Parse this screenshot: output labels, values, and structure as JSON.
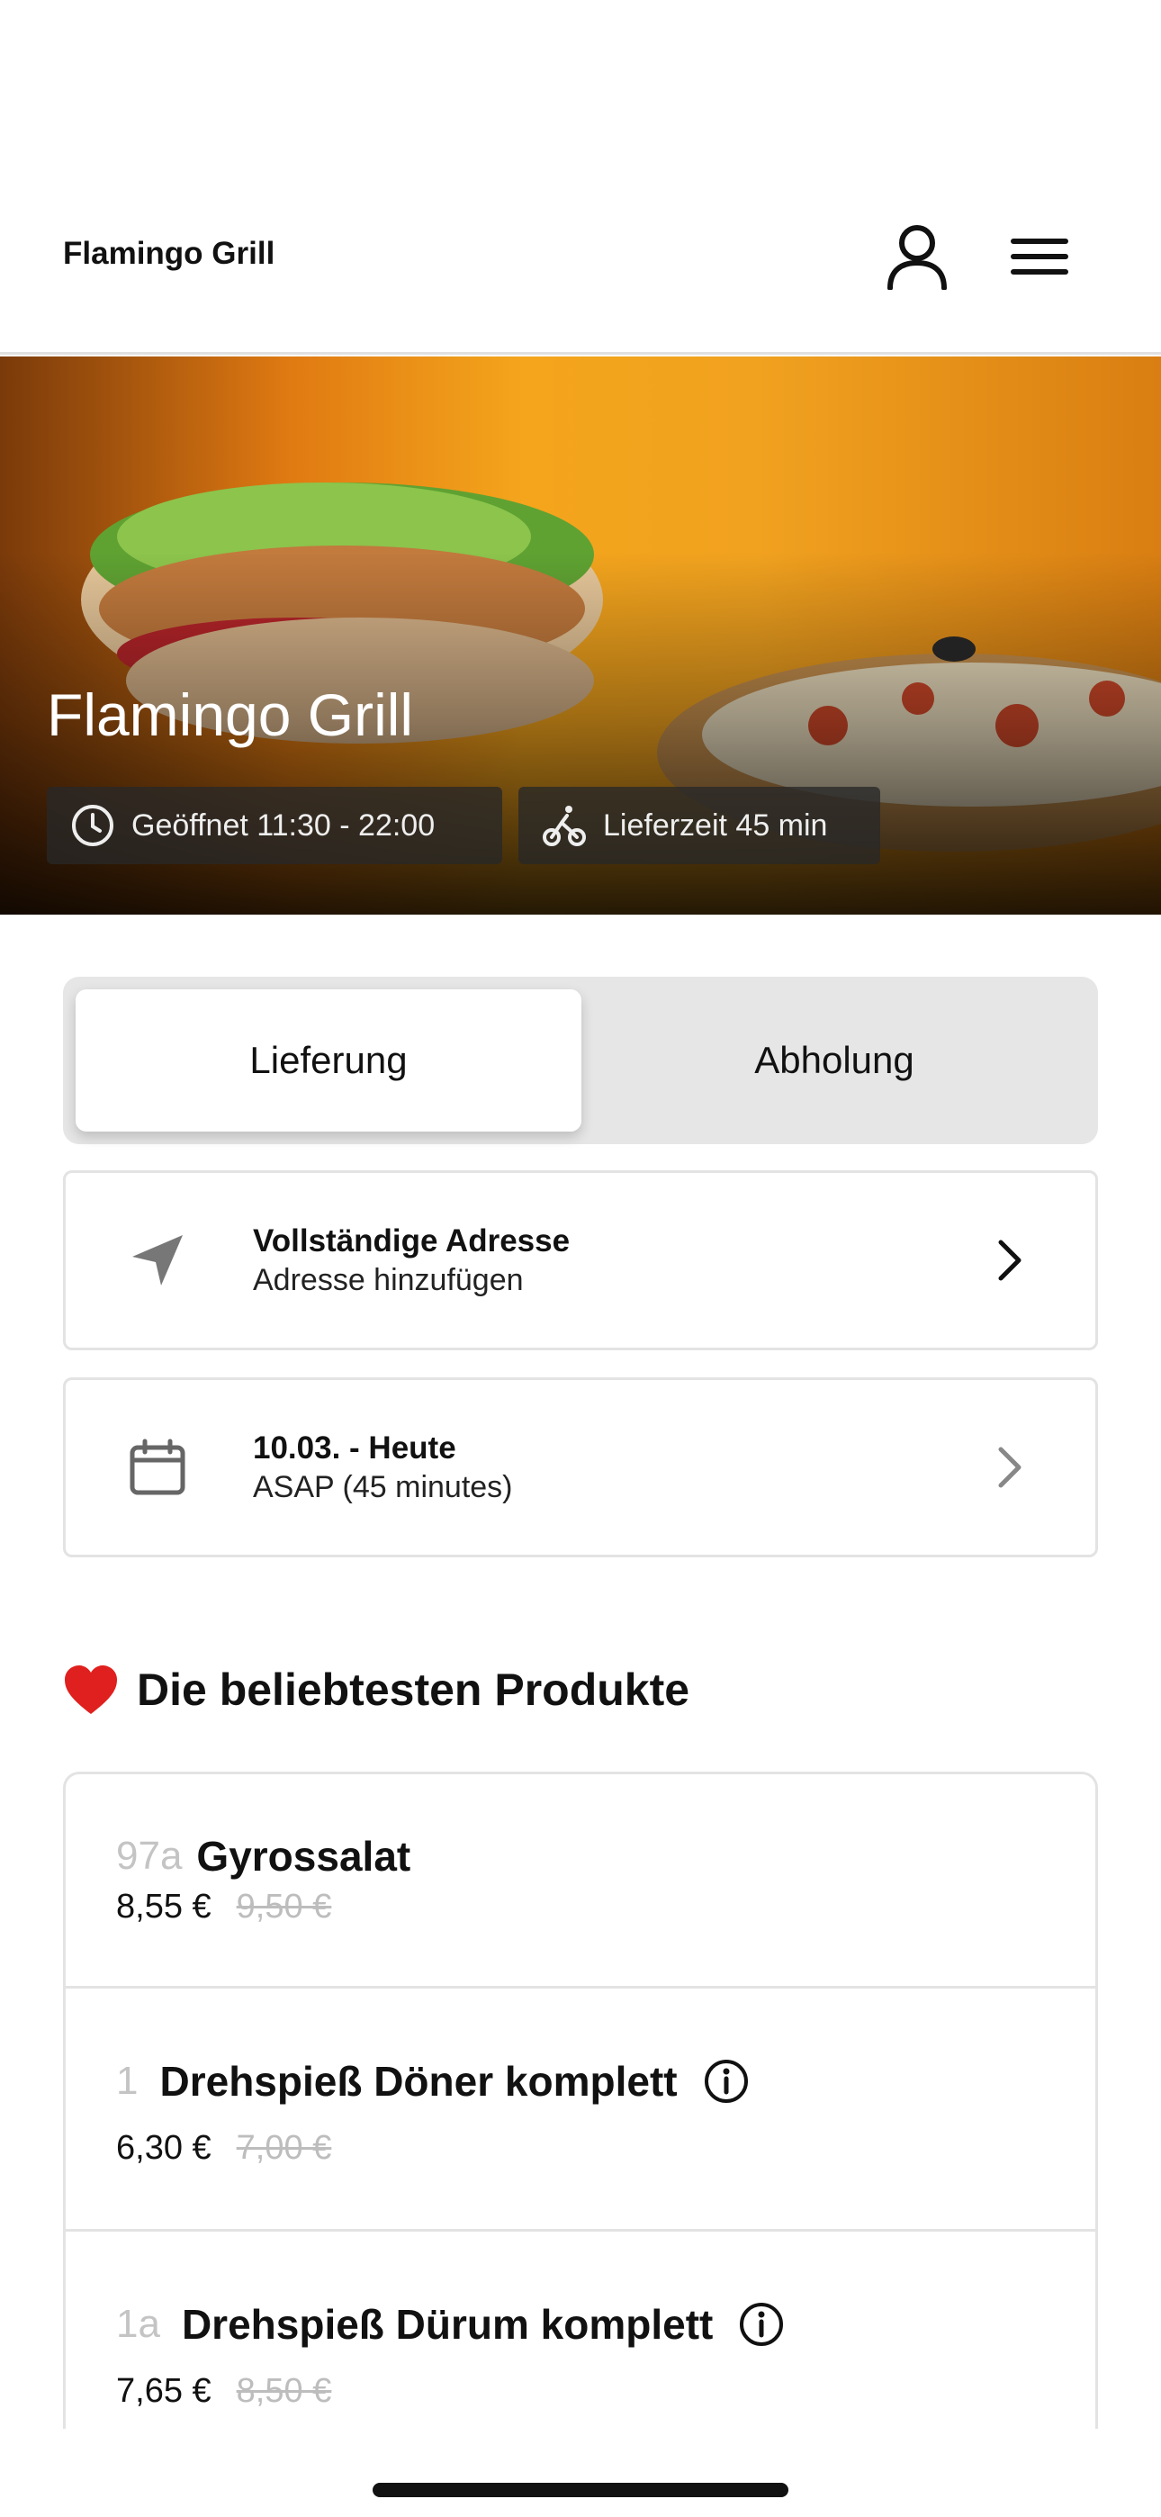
{
  "header": {
    "brand": "Flamingo Grill",
    "icons": [
      "user-icon",
      "menu-icon"
    ]
  },
  "hero": {
    "title": "Flamingo Grill",
    "open_label": "Geöffnet 11:30 - 22:00",
    "delivery_time_label": "Lieferzeit 45 min",
    "open_icon": "clock-icon",
    "delivery_icon": "bicycle-icon"
  },
  "mode_toggle": {
    "options": [
      "Lieferung",
      "Abholung"
    ],
    "selected": "Lieferung"
  },
  "address_card": {
    "title": "Vollständige Adresse",
    "subtitle": "Adresse hinzufügen",
    "icon": "location-arrow-icon"
  },
  "time_card": {
    "title": "10.03. - Heute",
    "subtitle": "ASAP (45 minutes)",
    "icon": "calendar-icon"
  },
  "popular": {
    "emoji": "❤️",
    "title": "Die beliebtesten Produkte",
    "products": [
      {
        "number": "97a",
        "name": "Gyrossalat",
        "price": "8,55 €",
        "old_price": "9,50 €",
        "has_info": false
      },
      {
        "number": "1",
        "name": "Drehspieß Döner komplett",
        "price": "6,30 €",
        "old_price": "7,00 €",
        "has_info": true
      },
      {
        "number": "1a",
        "name": "Drehspieß Dürum komplett",
        "price": "7,65 €",
        "old_price": "8,50 €",
        "has_info": true
      }
    ]
  },
  "colors": {
    "accent_dark": "#111111",
    "strikethrough": "#bdbdbd",
    "border": "#e3e3e3",
    "toggle_bg": "#e6e6e6",
    "heart": "#e0201e"
  }
}
